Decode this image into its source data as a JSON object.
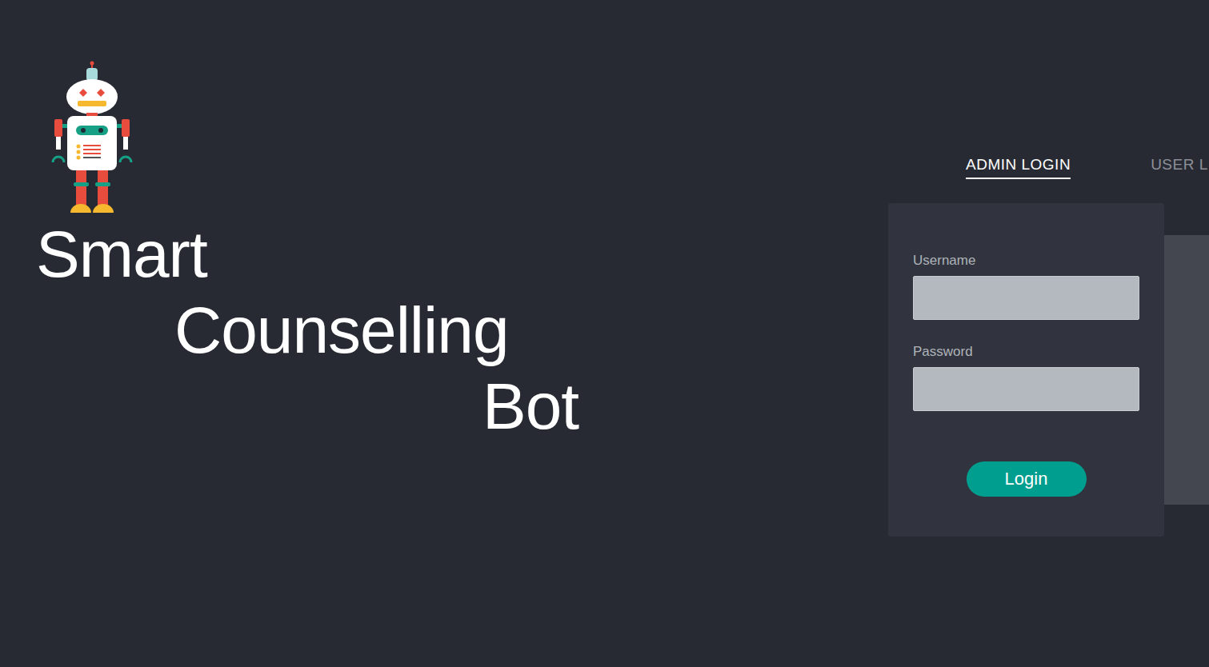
{
  "brand": {
    "title_lines": [
      "Smart",
      "Counselling",
      "Bot"
    ]
  },
  "tabs": [
    {
      "label": "ADMIN LOGIN",
      "selected": true
    },
    {
      "label": "USER L",
      "selected": false
    }
  ],
  "form": {
    "fields": [
      {
        "label": "Username",
        "value": ""
      },
      {
        "label": "Password",
        "value": ""
      }
    ],
    "submit": "Login"
  }
}
